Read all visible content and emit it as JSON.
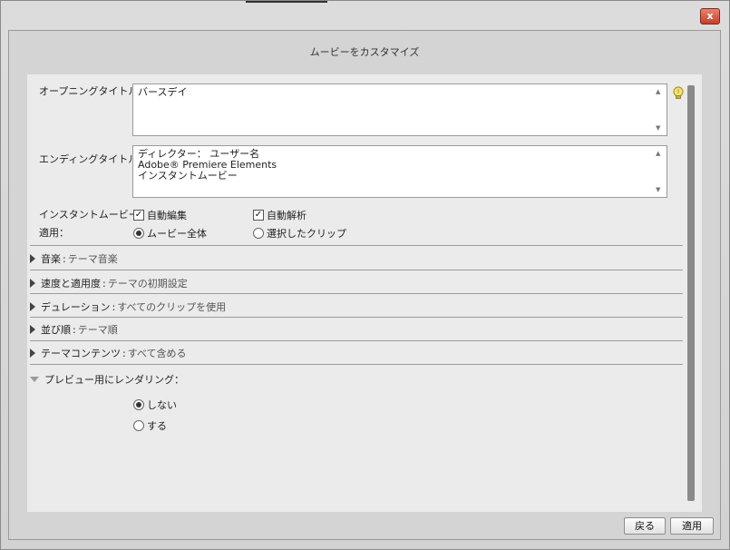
{
  "window": {
    "close_label": "x"
  },
  "dialog": {
    "title": "ムービーをカスタマイズ"
  },
  "opening": {
    "label": "オープニングタイトル：",
    "value": "バースデイ"
  },
  "ending": {
    "label": "エンディングタイトル：",
    "value": "ディレクター： ユーザー名\nAdobe® Premiere Elements\nインスタントムービー"
  },
  "instant": {
    "label": "インスタントムービー：",
    "auto_edit": "自動編集",
    "auto_analyze": "自動解析",
    "auto_edit_checked": true,
    "auto_analyze_checked": true
  },
  "apply": {
    "label": "適用：",
    "whole_movie": "ムービー全体",
    "selected_clips": "選択したクリップ",
    "selected": "whole_movie"
  },
  "sections": [
    {
      "title": "音楽",
      "value": "テーマ音楽"
    },
    {
      "title": "速度と適用度",
      "value": "テーマの初期設定"
    },
    {
      "title": "デュレーション",
      "value": "すべてのクリップを使用"
    },
    {
      "title": "並び順",
      "value": "テーマ順"
    },
    {
      "title": "テーマコンテンツ",
      "value": "すべて含める"
    }
  ],
  "preview": {
    "title": "プレビュー用にレンダリング：",
    "no_label": "しない",
    "yes_label": "する",
    "selected": "no"
  },
  "footer": {
    "back_label": "戻る",
    "apply_label": "適用"
  },
  "icons": {
    "hint": "lightbulb-icon",
    "close": "close-icon",
    "expand": "triangle-right-icon",
    "collapse": "triangle-down-icon"
  },
  "colors": {
    "accent_close": "#c8402a",
    "panel_bg": "#ebebeb"
  }
}
